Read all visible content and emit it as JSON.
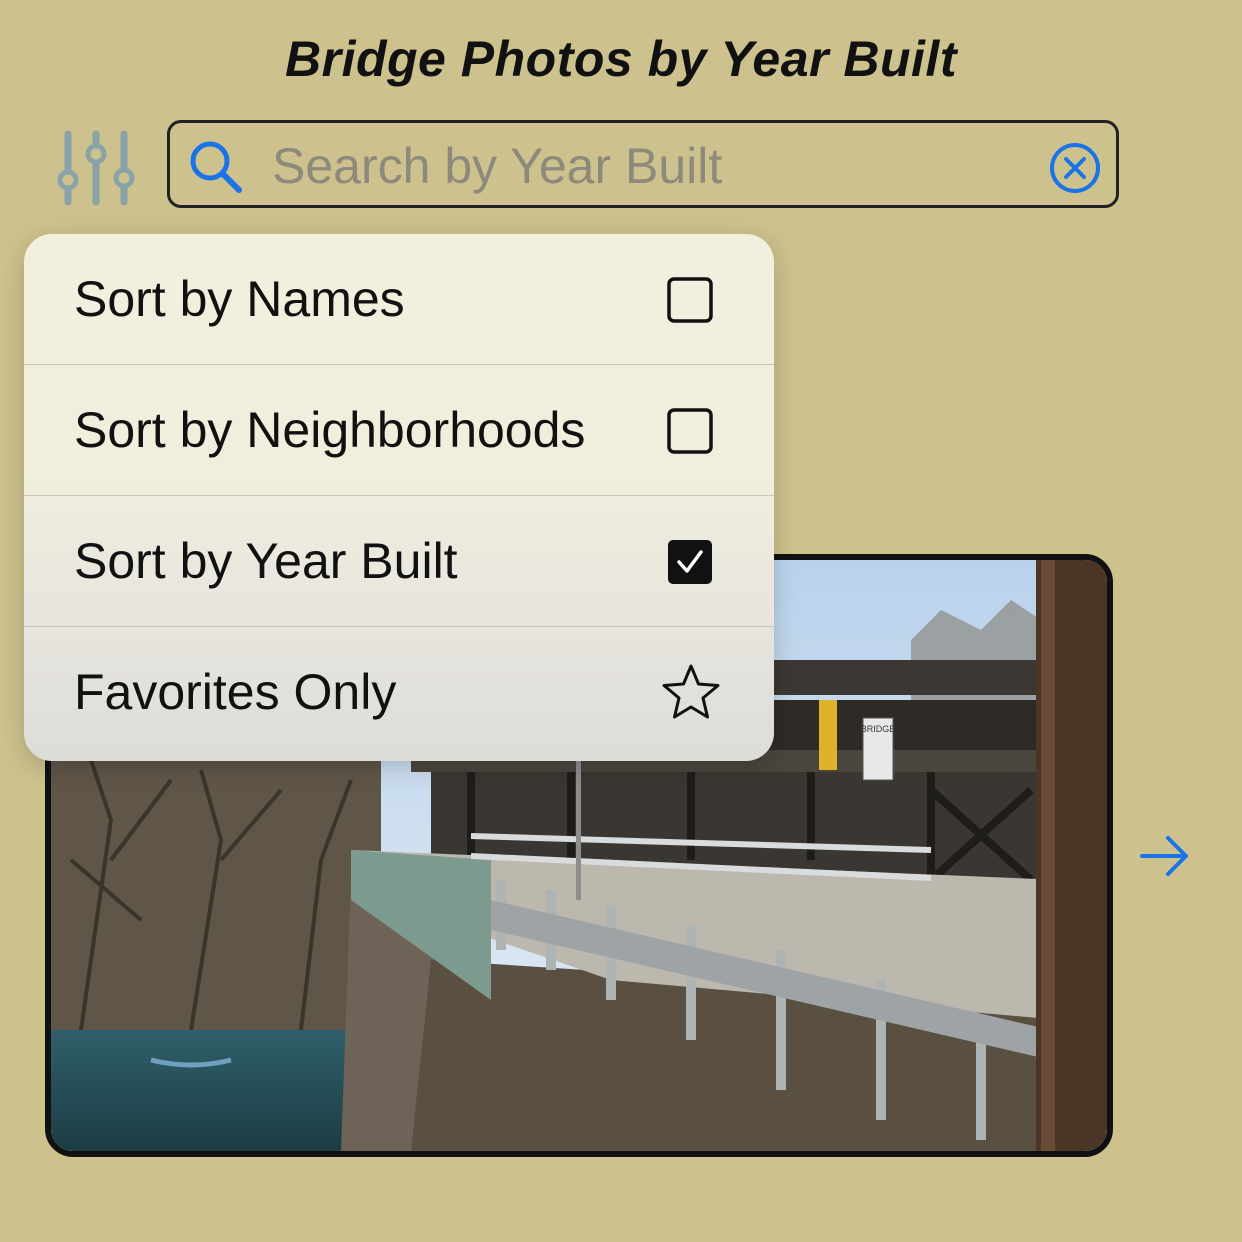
{
  "header": {
    "title": "Bridge Photos by Year Built"
  },
  "search": {
    "placeholder": "Search by Year Built",
    "value": ""
  },
  "menu": {
    "items": [
      {
        "label": "Sort by Names",
        "checked": false,
        "icon": "checkbox-icon"
      },
      {
        "label": "Sort by Neighborhoods",
        "checked": false,
        "icon": "checkbox-icon"
      },
      {
        "label": "Sort by Year Built",
        "checked": true,
        "icon": "checkbox-checked-icon"
      },
      {
        "label": "Favorites Only",
        "checked": false,
        "icon": "star-icon"
      }
    ]
  },
  "photo": {
    "sign_text": "BRIDGE"
  },
  "colors": {
    "background": "#cdc28d",
    "accent": "#1a73e8",
    "filter_icon": "#8aa3a8"
  }
}
